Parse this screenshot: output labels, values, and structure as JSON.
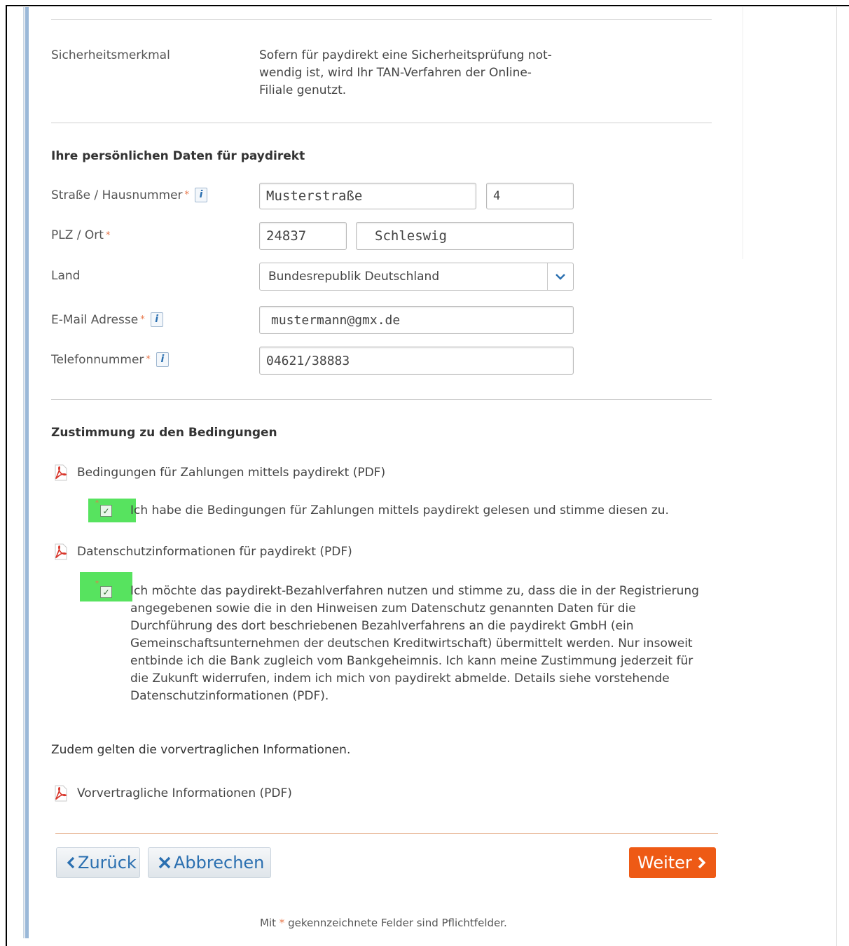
{
  "security": {
    "label": "Sicherheitsmerkmal",
    "text_lines": [
      "Sofern für paydirekt eine Sicherheitsprüfung not-",
      "wendig ist, wird Ihr TAN-Verfahren der Online-",
      "Filiale genutzt."
    ]
  },
  "personal": {
    "heading": "Ihre persönlichen Daten für paydirekt",
    "street_label": "Straße / Hausnummer",
    "street_value": "Musterstraße",
    "house_number_value": "4",
    "zip_city_label": "PLZ / Ort",
    "zip_value": "24837",
    "city_value": "Schleswig",
    "country_label": "Land",
    "country_value": "Bundesrepublik Deutschland",
    "email_label": "E-Mail Adresse",
    "email_value": "mustermann@gmx.de",
    "phone_label": "Telefonnummer",
    "phone_value": "04621/38883",
    "required_marker": "*",
    "info_glyph": "i"
  },
  "consent": {
    "heading": "Zustimmung zu den Bedingungen",
    "terms_pdf_link": "Bedingungen für Zahlungen mittels paydirekt (PDF)",
    "terms_checkbox_text": "Ich habe die Bedingungen für Zahlungen mittels paydirekt gelesen und stimme diesen zu.",
    "privacy_pdf_link": "Datenschutzinformationen für paydirekt (PDF)",
    "privacy_checkbox_lines": [
      "Ich möchte das paydirekt-Bezahlverfahren nutzen und stimme zu, dass die in der Registrierung",
      "angegebenen sowie die in den Hinweisen zum Datenschutz genannten Daten für die",
      "Durchführung des dort beschriebenen Bezahlverfahrens an die paydirekt GmbH (ein",
      "Gemeinschaftsunternehmen der deutschen Kreditwirtschaft) übermittelt werden. Nur insoweit",
      "entbinde ich die Bank zugleich vom Bankgeheimnis. Ich kann meine Zustimmung jederzeit für",
      "die Zukunft widerrufen, indem ich mich von paydirekt abmelde. Details siehe vorstehende",
      "Datenschutzinformationen (PDF)."
    ],
    "precontract_text": "Zudem gelten die vorvertraglichen Informationen.",
    "precontract_pdf_link": "Vorvertragliche Informationen (PDF)",
    "terms_checked": true,
    "privacy_checked": true
  },
  "actions": {
    "back_label": "Zurück",
    "back_icon": "chevron-left-icon",
    "cancel_label": "Abbrechen",
    "cancel_icon": "close-icon",
    "next_label": "Weiter",
    "next_icon": "chevron-right-icon"
  },
  "footnote": {
    "prefix": "Mit",
    "marker": "*",
    "suffix": "gekennzeichnete Felder sind Pflichtfelder."
  },
  "colors": {
    "accent_orange": "#ee5a15",
    "link_blue": "#2a6fb0",
    "checkbox_highlight": "#57e35f",
    "required_marker": "#e8774a"
  }
}
